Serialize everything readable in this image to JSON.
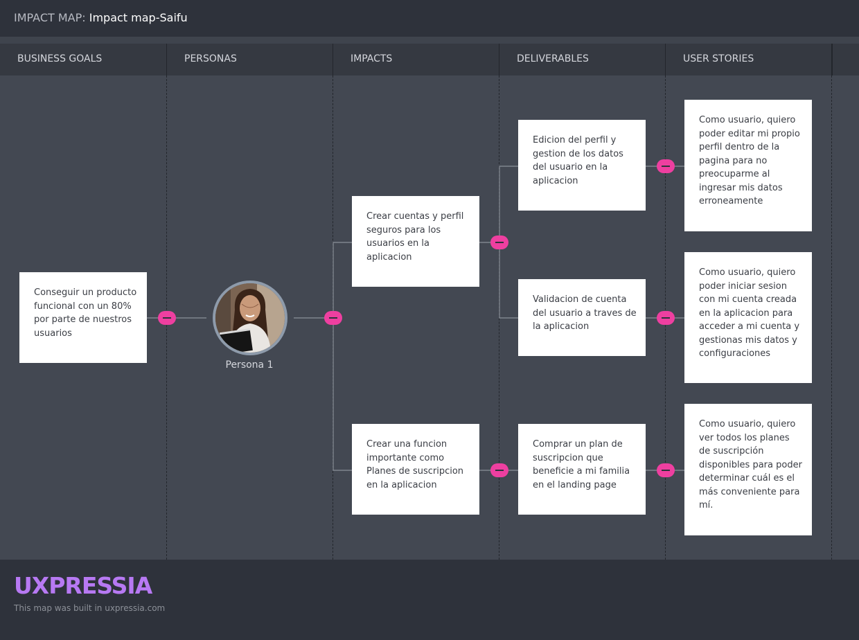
{
  "header": {
    "prefix": "IMPACT MAP:",
    "title": "Impact map-Saifu"
  },
  "columns": [
    "BUSINESS GOALS",
    "PERSONAS",
    "IMPACTS",
    "DELIVERABLES",
    "USER STORIES"
  ],
  "goal": {
    "text": "Conseguir un producto funcional con un 80% por parte de nuestros usuarios"
  },
  "persona": {
    "name": "Persona 1"
  },
  "impacts": [
    {
      "text": "Crear cuentas y perfil seguros para los usuarios en la aplicacion"
    },
    {
      "text": "Crear una funcion importante como Planes de suscripcion en la aplicacion"
    }
  ],
  "deliverables": [
    {
      "text": "Edicion del perfil y gestion de los datos del usuario en la aplicacion"
    },
    {
      "text": "Validacion de cuenta del usuario a traves de la aplicacion"
    },
    {
      "text": "Comprar un plan de suscripcion que beneficie a mi familia en el landing page"
    }
  ],
  "user_stories": [
    {
      "text": "Como usuario, quiero poder editar mi propio perfil dentro de la pagina para no preocuparme al ingresar mis datos erroneamente"
    },
    {
      "text": "Como usuario, quiero poder iniciar sesion con mi cuenta creada en la aplicacion para acceder a mi cuenta y gestionas mis datos y configuraciones"
    },
    {
      "text": "Como usuario, quiero ver todos los planes de suscripción disponibles para poder determinar cuál es el más conveniente para mí."
    }
  ],
  "footer": {
    "logo": "UXPRESSIA",
    "built": "This map was built in uxpressia.com"
  },
  "colors": {
    "accent": "#ee3fa0",
    "logo": "#b779f3",
    "card": "#ffffff",
    "canvas": "#434852",
    "header": "#2e323b"
  },
  "icons": [
    "collapse-toggle-icon",
    "persona-avatar"
  ]
}
